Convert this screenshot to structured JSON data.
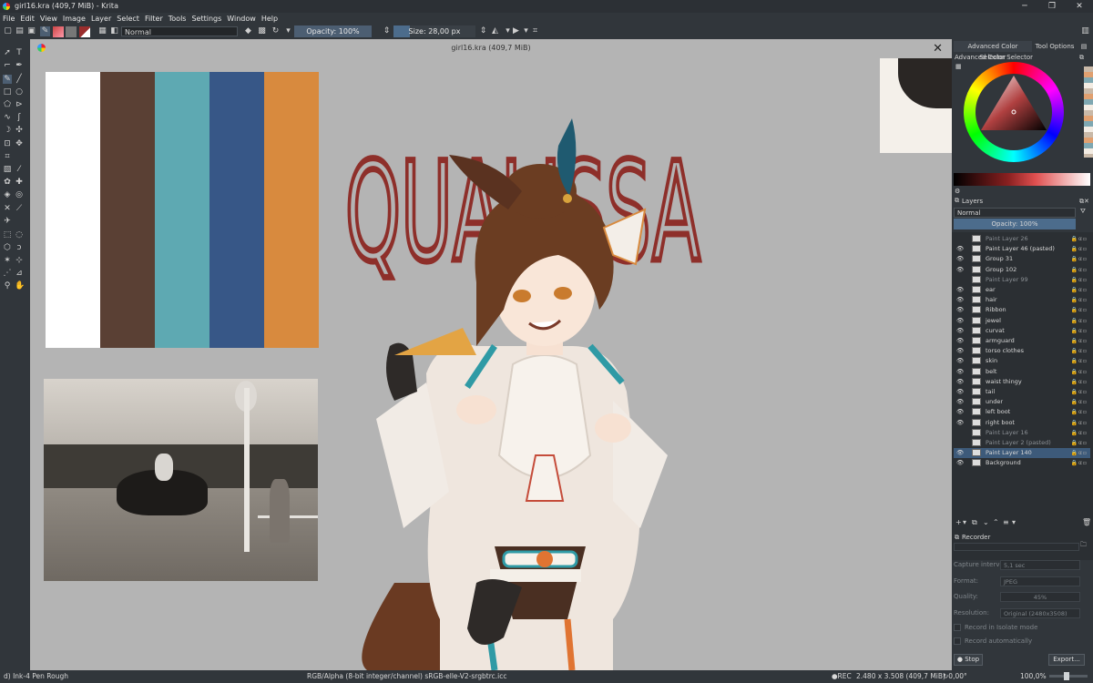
{
  "window": {
    "title": "girl16.kra (409,7 MiB)  - Krita"
  },
  "menu": [
    "File",
    "Edit",
    "View",
    "Image",
    "Layer",
    "Select",
    "Filter",
    "Tools",
    "Settings",
    "Window",
    "Help"
  ],
  "toolbar": {
    "blend_mode": "Normal",
    "opacity_label": "Opacity: 100%",
    "size_label": "Size: 28,00 px"
  },
  "canvas": {
    "doc_title": "girl16.kra (409,7 MiB)",
    "title_art_text": "QUALISSA",
    "palette_colors": [
      "#ffffff",
      "#5a4034",
      "#5ea9b2",
      "#375787",
      "#d88a3e"
    ]
  },
  "docker": {
    "tab_color": "Advanced Color Selector",
    "tab_tool": "Tool Options",
    "color_header": "Advanced Color Selector",
    "layers_header": "Layers",
    "layers_blend": "Normal",
    "layers_opacity": "Opacity:  100%",
    "layers": [
      {
        "name": "Paint Layer 26",
        "dim": true
      },
      {
        "name": "Paint Layer 46 (pasted)",
        "dim": false
      },
      {
        "name": "Group 31",
        "dim": false
      },
      {
        "name": "Group 102",
        "dim": false
      },
      {
        "name": "Paint Layer 99",
        "dim": true
      },
      {
        "name": "ear",
        "dim": false
      },
      {
        "name": "hair",
        "dim": false
      },
      {
        "name": "Ribbon",
        "dim": false
      },
      {
        "name": "jewel",
        "dim": false
      },
      {
        "name": "curvat",
        "dim": false
      },
      {
        "name": "armguard",
        "dim": false
      },
      {
        "name": "torso clothes",
        "dim": false
      },
      {
        "name": "skin",
        "dim": false
      },
      {
        "name": "belt",
        "dim": false
      },
      {
        "name": "waist thingy",
        "dim": false
      },
      {
        "name": "tail",
        "dim": false
      },
      {
        "name": "under",
        "dim": false
      },
      {
        "name": "left boot",
        "dim": false
      },
      {
        "name": "right boot",
        "dim": false
      },
      {
        "name": "Paint Layer 16",
        "dim": true
      },
      {
        "name": "Paint Layer 2 (pasted)",
        "dim": true
      },
      {
        "name": "Paint Layer 140",
        "dim": false,
        "selected": true
      },
      {
        "name": "Background",
        "dim": false
      }
    ],
    "recorder_header": "Recorder",
    "recorder": {
      "capture_label": "Capture interval:",
      "capture_value": "5,1 sec",
      "format_label": "Format:",
      "format_value": "JPEG",
      "quality_label": "Quality:",
      "quality_value": "45%",
      "resolution_label": "Resolution:",
      "resolution_value": "Original (2480x3508)",
      "isolate_label": "Record in Isolate mode",
      "auto_label": "Record automatically",
      "stop_label": "Stop",
      "export_label": "Export..."
    }
  },
  "status": {
    "brush": "d) Ink-4 Pen Rough",
    "color_space": "RGB/Alpha (8-bit integer/channel)  sRGB-elle-V2-srgbtrc.icc",
    "rec": "REC",
    "dimensions": "2.480 x 3.508 (409,7 MiB)",
    "rotation": "0,00°",
    "zoom": "100,0%"
  }
}
